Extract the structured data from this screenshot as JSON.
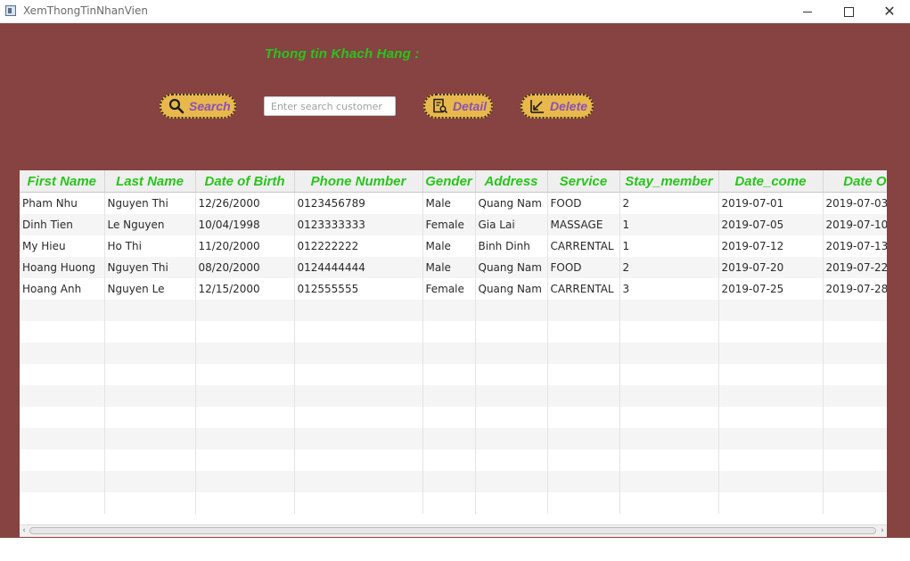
{
  "window": {
    "title": "XemThongTinNhanVien"
  },
  "heading": "Thong tin Khach Hang :",
  "toolbar": {
    "search_label": "Search",
    "search_placeholder": "Enter search customer",
    "search_value": "",
    "detail_label": "Detail",
    "delete_label": "Delete"
  },
  "colors": {
    "background": "#864342",
    "accent_green": "#27c51b",
    "button_fill": "#e9b84d",
    "button_text": "#8b50b6"
  },
  "table": {
    "columns": [
      "First Name",
      "Last Name",
      "Date of Birth",
      "Phone Number",
      "Gender",
      "Address",
      "Service",
      "Stay_member",
      "Date_come",
      "Date Out"
    ],
    "rows": [
      [
        "Pham Nhu",
        "Nguyen Thi",
        "12/26/2000",
        "0123456789",
        "Male",
        "Quang Nam",
        "FOOD",
        "2",
        "2019-07-01",
        "2019-07-03"
      ],
      [
        "Dinh Tien",
        "Le Nguyen",
        "10/04/1998",
        "0123333333",
        "Female",
        "Gia Lai",
        "MASSAGE",
        "1",
        "2019-07-05",
        "2019-07-10"
      ],
      [
        "My Hieu",
        "Ho Thi",
        "11/20/2000",
        "012222222",
        "Male",
        "Binh Dinh",
        "CARRENTAL",
        "1",
        "2019-07-12",
        "2019-07-13"
      ],
      [
        "Hoang Huong",
        "Nguyen Thi",
        "08/20/2000",
        "0124444444",
        "Male",
        "Quang Nam",
        "FOOD",
        "2",
        "2019-07-20",
        "2019-07-22"
      ],
      [
        "Hoang Anh",
        "Nguyen Le",
        "12/15/2000",
        "012555555",
        "Female",
        "Quang Nam",
        "CARRENTAL",
        "3",
        "2019-07-25",
        "2019-07-28"
      ]
    ]
  },
  "icons": {
    "search": "magnifier-icon",
    "detail": "document-search-icon",
    "delete": "arrow-down-left-icon"
  }
}
